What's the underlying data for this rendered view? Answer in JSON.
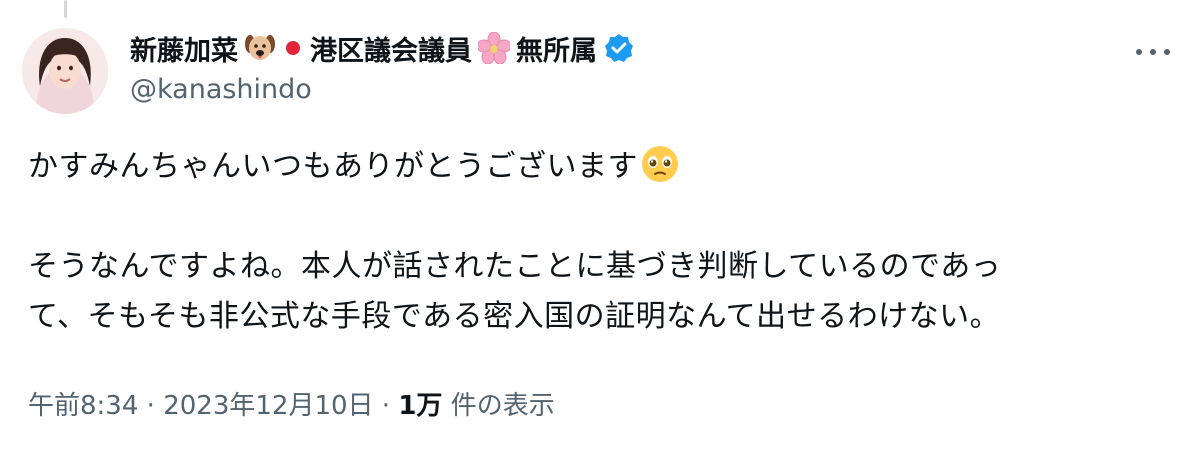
{
  "tweet": {
    "display_name_part1": "新藤加菜",
    "display_name_part2": "港区議会議員",
    "display_name_part3": "無所属",
    "handle": "@kanashindo",
    "text_line1": "かすみんちゃんいつもありがとうございます",
    "text_para2_line1": "そうなんですよね。本人が話されたことに基づき判断しているのであっ",
    "text_para2_line2": "て、そもそも非公式な手段である密入国の証明なんて出せるわけない。",
    "time": "午前8:34",
    "date": "2023年12月10日",
    "views_count": "1万",
    "views_label": "件の表示",
    "separator": "·"
  },
  "icons": {
    "name_emojis": [
      "dog-face-icon",
      "red-circle-icon",
      "cherry-blossom-icon"
    ],
    "verified": "verified-badge-icon",
    "text_emoji": "pleading-face-icon",
    "more": "more-options-icon"
  },
  "colors": {
    "verified_blue": "#1d9bf0",
    "secondary_text": "#536471",
    "primary_text": "#0f1419"
  }
}
